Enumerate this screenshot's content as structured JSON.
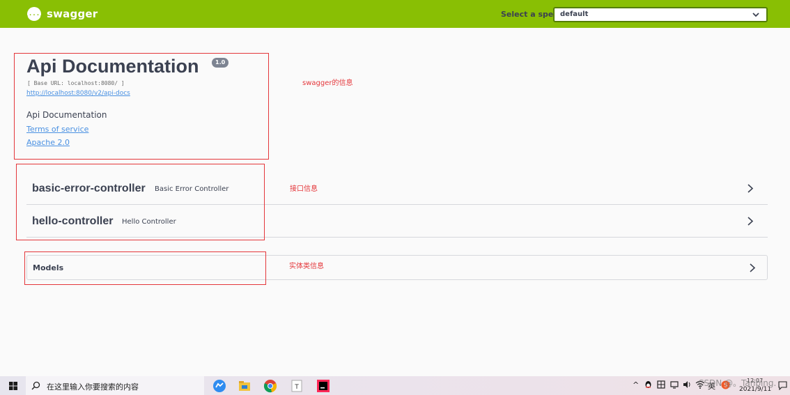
{
  "header": {
    "logo_text": "swagger",
    "logo_mark": "{...}",
    "spec_label": "Select a spec",
    "spec_value": "default"
  },
  "info": {
    "title": "Api Documentation",
    "version": "1.0",
    "base_url": "[ Base URL: localhost:8080/ ]",
    "docs_link": "http://localhost:8080/v2/api-docs",
    "description": "Api Documentation",
    "terms_link": "Terms of service",
    "license_link": "Apache 2.0"
  },
  "controllers": [
    {
      "name": "basic-error-controller",
      "description": "Basic Error Controller"
    },
    {
      "name": "hello-controller",
      "description": "Hello Controller"
    }
  ],
  "models": {
    "label": "Models"
  },
  "annotations": {
    "info_note": "swagger的信息",
    "api_note": "接口信息",
    "model_note": "实体类信息"
  },
  "taskbar": {
    "search_placeholder": "在这里输入你要搜索的内容",
    "time": "12:07",
    "date": "2021/9/11",
    "ime": "英",
    "watermark": "CSDN @。Tanbing."
  },
  "colors": {
    "topbar": "#89bf04",
    "link": "#4990e2",
    "annotation": "#e4363a",
    "text": "#3b4151"
  }
}
